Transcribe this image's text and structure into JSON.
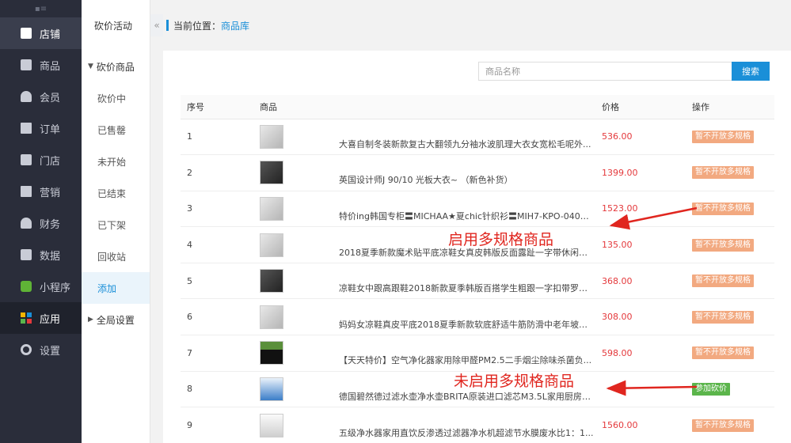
{
  "nav": {
    "items": [
      {
        "label": "店铺",
        "icon": "store-icon",
        "state": "active"
      },
      {
        "label": "商品",
        "icon": "goods-icon"
      },
      {
        "label": "会员",
        "icon": "member-icon"
      },
      {
        "label": "订单",
        "icon": "order-icon"
      },
      {
        "label": "门店",
        "icon": "shop-icon"
      },
      {
        "label": "营销",
        "icon": "marketing-icon"
      },
      {
        "label": "财务",
        "icon": "finance-icon"
      },
      {
        "label": "数据",
        "icon": "data-icon"
      },
      {
        "label": "小程序",
        "icon": "miniprogram-icon"
      },
      {
        "label": "应用",
        "icon": "apps-icon",
        "state": "app-active"
      },
      {
        "label": "设置",
        "icon": "gear-icon"
      }
    ]
  },
  "submenu": {
    "title": "砍价活动",
    "group1": "砍价商品",
    "items": [
      "砍价中",
      "已售罄",
      "未开始",
      "已结束",
      "已下架",
      "回收站",
      "添加"
    ],
    "group2": "全局设置"
  },
  "breadcrumb": {
    "label": "当前位置：",
    "link": "商品库"
  },
  "search": {
    "placeholder": "商品名称",
    "button": "搜索"
  },
  "table": {
    "headers": [
      "序号",
      "商品",
      "价格",
      "操作"
    ],
    "rows": [
      {
        "no": "1",
        "name": "大喜自制冬装新款复古大翻领九分袖水波肌理大衣女宽松毛呢外...",
        "price": "536.00",
        "action": "暂不开放多规格",
        "thumb": "light"
      },
      {
        "no": "2",
        "name": "英国设计师J 90/10 光板大衣~ （新色补货）",
        "price": "1399.00",
        "action": "暂不开放多规格",
        "thumb": "dark"
      },
      {
        "no": "3",
        "name": "特价ing韩国专柜〓MICHAA★夏chic针织衫〓MIH7-KPO-040〓...",
        "price": "1523.00",
        "action": "暂不开放多规格",
        "thumb": "light"
      },
      {
        "no": "4",
        "name": "2018夏季新款魔术贴平底凉鞋女真皮韩版反面露趾一字带休闲女...",
        "price": "135.00",
        "action": "暂不开放多规格",
        "thumb": "light"
      },
      {
        "no": "5",
        "name": "凉鞋女中跟高跟鞋2018新款夏季韩版百搭学生粗跟一字扣带罗马...",
        "price": "368.00",
        "action": "暂不开放多规格",
        "thumb": "dark"
      },
      {
        "no": "6",
        "name": "妈妈女凉鞋真皮平底2018夏季新款软底舒适牛筋防滑中老年坡跟...",
        "price": "308.00",
        "action": "暂不开放多规格",
        "thumb": "light"
      },
      {
        "no": "7",
        "name": "【天天特价】空气净化器家用除甲醛PM2.5二手烟尘除味杀菌负...",
        "price": "598.00",
        "action": "暂不开放多规格",
        "thumb": "box"
      },
      {
        "no": "8",
        "name": "德国碧然德过滤水壶净水壶BRITA原装进口滤芯M3.5L家用厨房净...",
        "price": "",
        "action": "参加砍价",
        "thumb": "blue"
      },
      {
        "no": "9",
        "name": "五级净水器家用直饮反渗透过滤器净水机超滤节水膜废水比1：1...",
        "price": "1560.00",
        "action": "暂不开放多规格",
        "thumb": "white"
      }
    ]
  },
  "annotations": {
    "multi_spec": "启用多规格商品",
    "no_multi_spec": "未启用多规格商品"
  },
  "colors": {
    "accent": "#1a8fd8",
    "price": "#e4393c",
    "badge_off": "#f2a980",
    "badge_on": "#5bb54b",
    "annotation": "#e0261f"
  }
}
